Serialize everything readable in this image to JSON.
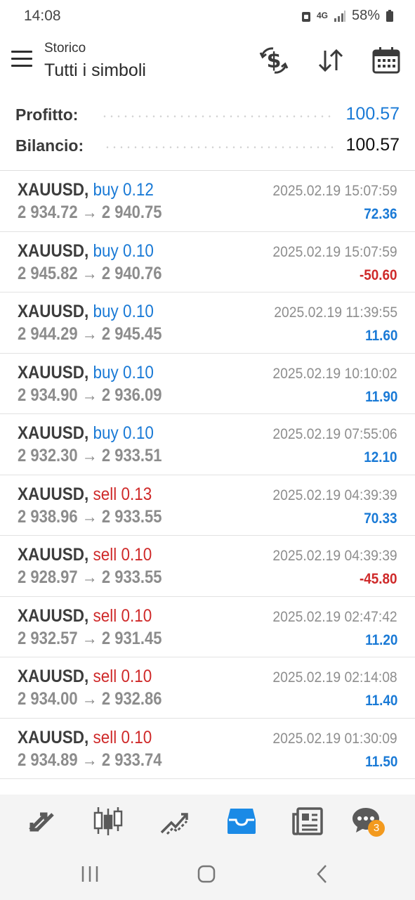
{
  "status_bar": {
    "time": "14:08",
    "network": "4G",
    "battery": "58%"
  },
  "header": {
    "small_title": "Storico",
    "title": "Tutti i simboli",
    "icons": [
      "exchange-dollar-icon",
      "sort-arrows-icon",
      "calendar-icon"
    ]
  },
  "summary": {
    "profit_label": "Profitto:",
    "profit_value": "100.57",
    "balance_label": "Bilancio:",
    "balance_value": "100.57"
  },
  "trades": [
    {
      "symbol": "XAUUSD,",
      "side": "buy 0.12",
      "type": "buy",
      "prices": "2 934.72 → 2 940.75",
      "datetime": "2025.02.19 15:07:59",
      "profit": "72.36",
      "profit_sign": "pos"
    },
    {
      "symbol": "XAUUSD,",
      "side": "buy 0.10",
      "type": "buy",
      "prices": "2 945.82 → 2 940.76",
      "datetime": "2025.02.19 15:07:59",
      "profit": "-50.60",
      "profit_sign": "neg"
    },
    {
      "symbol": "XAUUSD,",
      "side": "buy 0.10",
      "type": "buy",
      "prices": "2 944.29 → 2 945.45",
      "datetime": "2025.02.19 11:39:55",
      "profit": "11.60",
      "profit_sign": "pos"
    },
    {
      "symbol": "XAUUSD,",
      "side": "buy 0.10",
      "type": "buy",
      "prices": "2 934.90 → 2 936.09",
      "datetime": "2025.02.19 10:10:02",
      "profit": "11.90",
      "profit_sign": "pos"
    },
    {
      "symbol": "XAUUSD,",
      "side": "buy 0.10",
      "type": "buy",
      "prices": "2 932.30 → 2 933.51",
      "datetime": "2025.02.19 07:55:06",
      "profit": "12.10",
      "profit_sign": "pos"
    },
    {
      "symbol": "XAUUSD,",
      "side": "sell 0.13",
      "type": "sell",
      "prices": "2 938.96 → 2 933.55",
      "datetime": "2025.02.19 04:39:39",
      "profit": "70.33",
      "profit_sign": "pos"
    },
    {
      "symbol": "XAUUSD,",
      "side": "sell 0.10",
      "type": "sell",
      "prices": "2 928.97 → 2 933.55",
      "datetime": "2025.02.19 04:39:39",
      "profit": "-45.80",
      "profit_sign": "neg"
    },
    {
      "symbol": "XAUUSD,",
      "side": "sell 0.10",
      "type": "sell",
      "prices": "2 932.57 → 2 931.45",
      "datetime": "2025.02.19 02:47:42",
      "profit": "11.20",
      "profit_sign": "pos"
    },
    {
      "symbol": "XAUUSD,",
      "side": "sell 0.10",
      "type": "sell",
      "prices": "2 934.00 → 2 932.86",
      "datetime": "2025.02.19 02:14:08",
      "profit": "11.40",
      "profit_sign": "pos"
    },
    {
      "symbol": "XAUUSD,",
      "side": "sell 0.10",
      "type": "sell",
      "prices": "2 934.89 → 2 933.74",
      "datetime": "2025.02.19 01:30:09",
      "profit": "11.50",
      "profit_sign": "pos"
    }
  ],
  "bottom_nav": {
    "items": [
      "quotes-icon",
      "chart-icon",
      "trade-icon",
      "history-icon",
      "news-icon",
      "chat-icon"
    ],
    "active": "history-icon",
    "chat_badge": "3"
  },
  "colors": {
    "accent_blue": "#1a7ad6",
    "loss_red": "#cf2a2a",
    "badge_orange": "#f39a1e"
  }
}
